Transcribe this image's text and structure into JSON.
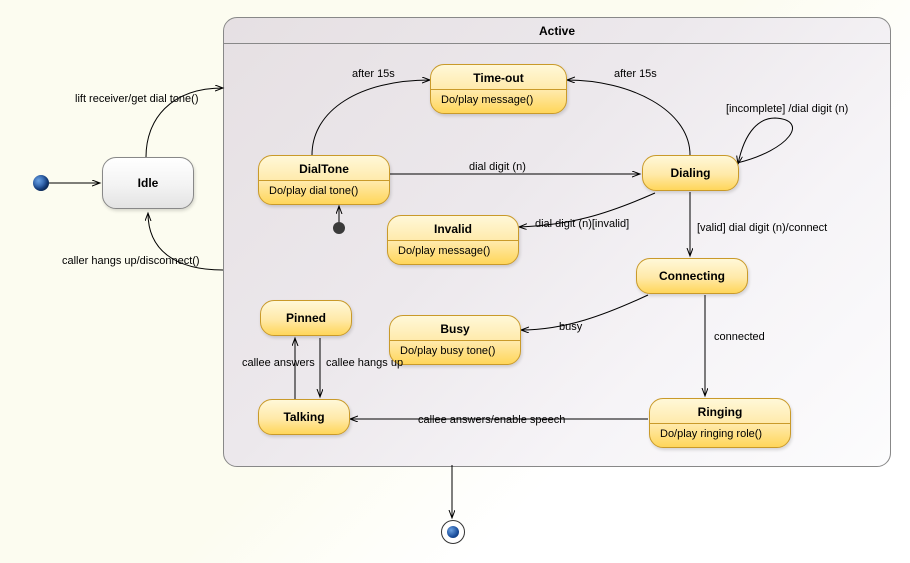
{
  "diagram_type": "UML State Machine",
  "composite": {
    "title": "Active"
  },
  "states": {
    "idle": {
      "name": "Idle"
    },
    "dialtone": {
      "name": "DialTone",
      "activity": "Do/play dial tone()"
    },
    "timeout": {
      "name": "Time-out",
      "activity": "Do/play message()"
    },
    "dialing": {
      "name": "Dialing"
    },
    "invalid": {
      "name": "Invalid",
      "activity": "Do/play message()"
    },
    "connecting": {
      "name": "Connecting"
    },
    "busy": {
      "name": "Busy",
      "activity": "Do/play busy tone()"
    },
    "ringing": {
      "name": "Ringing",
      "activity": "Do/play ringing role()"
    },
    "talking": {
      "name": "Talking"
    },
    "pinned": {
      "name": "Pinned"
    }
  },
  "transitions": {
    "initial_to_idle": "",
    "idle_to_active": "lift receiver/get dial tone()",
    "active_to_idle": "caller hangs up/disconnect()",
    "inner_initial_to_dt": "",
    "dt_to_timeout": "after 15s",
    "dt_to_dialing": "dial digit (n)",
    "dialing_to_timeout": "after 15s",
    "dialing_self": "[incomplete] /dial digit (n)",
    "dialing_to_invalid": "dial digit (n)[invalid]",
    "dialing_to_connecting": "[valid] dial digit (n)/connect",
    "connecting_to_busy": "busy",
    "connecting_to_ringing": "connected",
    "ringing_to_talking": "callee answers/enable speech",
    "talking_to_pinned": "callee answers",
    "pinned_to_talking": "callee hangs up",
    "active_to_final": ""
  }
}
